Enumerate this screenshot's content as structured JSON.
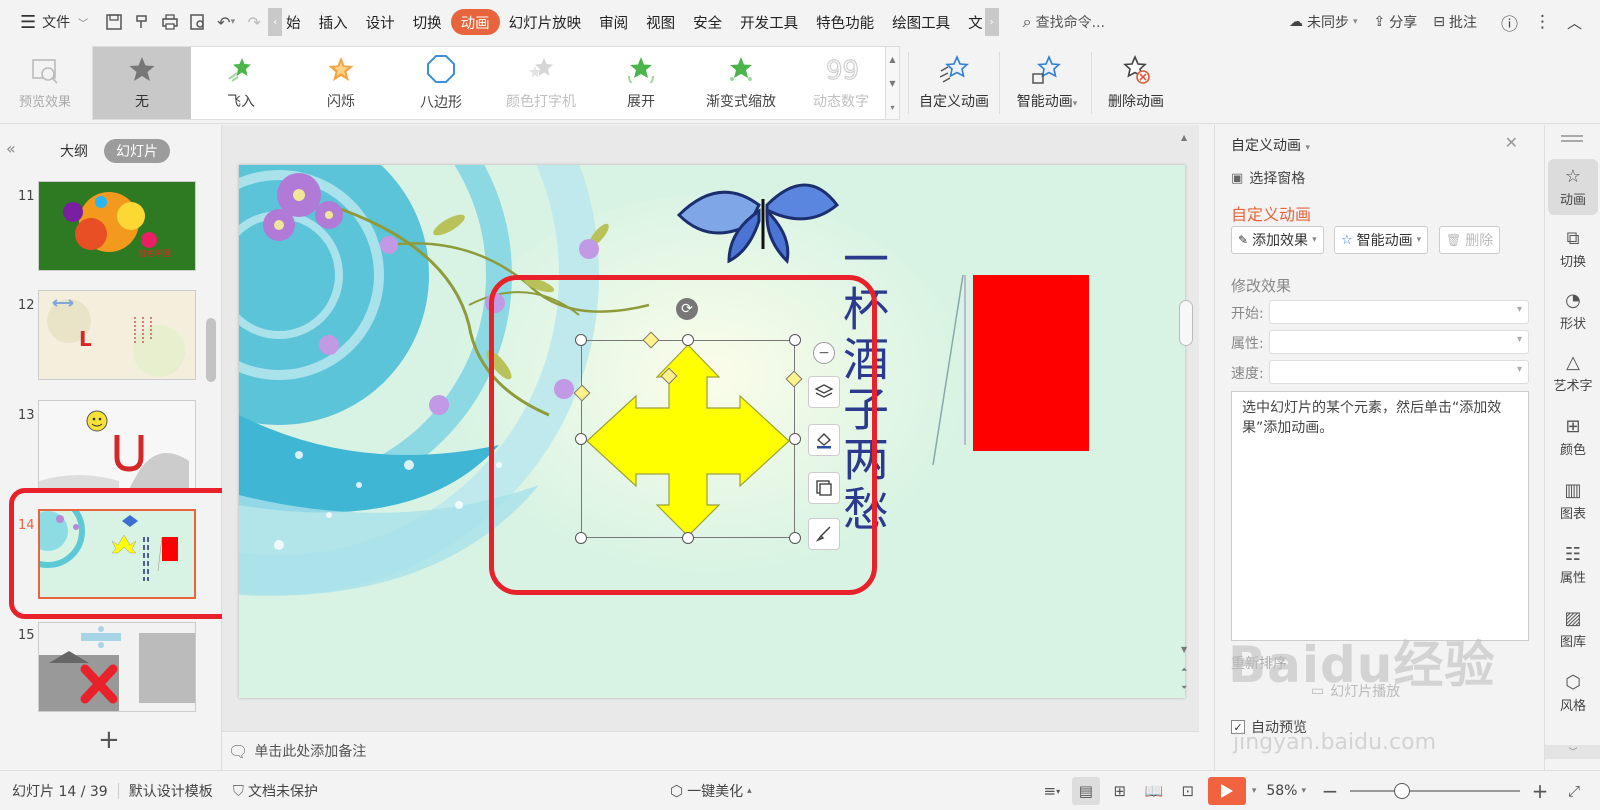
{
  "menubar": {
    "file_label": "文件",
    "tabs": [
      "始",
      "插入",
      "设计",
      "切换",
      "动画",
      "幻灯片放映",
      "审阅",
      "视图",
      "安全",
      "开发工具",
      "特色功能",
      "绘图工具",
      "文"
    ],
    "active_tab": "动画",
    "search_placeholder": "查找命令...",
    "sync_label": "未同步",
    "share_label": "分享",
    "comment_label": "批注"
  },
  "ribbon": {
    "preview_label": "预览效果",
    "gallery": [
      {
        "label": "无",
        "icon": "star-gray-icon",
        "state": "selected"
      },
      {
        "label": "飞入",
        "icon": "star-green-icon",
        "state": "normal"
      },
      {
        "label": "闪烁",
        "icon": "star-orange-icon",
        "state": "normal"
      },
      {
        "label": "八边形",
        "icon": "octagon-icon",
        "state": "normal"
      },
      {
        "label": "颜色打字机",
        "icon": "star-faded-icon",
        "state": "disabled"
      },
      {
        "label": "展开",
        "icon": "star-green-icon",
        "state": "normal"
      },
      {
        "label": "渐变式缩放",
        "icon": "star-green-icon",
        "state": "normal"
      },
      {
        "label": "动态数字",
        "icon": "number-99-icon",
        "state": "disabled"
      }
    ],
    "custom_anim_label": "自定义动画",
    "smart_anim_label": "智能动画",
    "delete_anim_label": "删除动画"
  },
  "left_panel": {
    "tab_outline": "大纲",
    "tab_slides": "幻灯片",
    "slides": [
      {
        "num": "11"
      },
      {
        "num": "12"
      },
      {
        "num": "13"
      },
      {
        "num": "14"
      },
      {
        "num": "15"
      }
    ],
    "current_slide": "14",
    "add_symbol": "+",
    "thumb12_text": "L",
    "thumb11_text": "红色中国"
  },
  "slide": {
    "vertical_text": "一杯酒子两愁"
  },
  "notes": {
    "placeholder": "单击此处添加备注"
  },
  "right_panel": {
    "title": "自定义动画",
    "select_pane": "选择窗格",
    "heading": "自定义动画",
    "add_effect": "添加效果",
    "smart_anim": "智能动画",
    "delete": "删除",
    "modify_label": "修改效果",
    "start_label": "开始:",
    "property_label": "属性:",
    "speed_label": "速度:",
    "hint": "选中幻灯片的某个元素，然后单击“添加效果”添加动画。",
    "reorder_label": "重新排序",
    "play_label": "幻灯片播放",
    "auto_preview": "自动预览"
  },
  "sidebar": [
    {
      "label": "动画",
      "icon": "animation-icon",
      "active": true
    },
    {
      "label": "切换",
      "icon": "transition-icon",
      "active": false
    },
    {
      "label": "形状",
      "icon": "shape-icon",
      "active": false
    },
    {
      "label": "艺术字",
      "icon": "wordart-icon",
      "active": false
    },
    {
      "label": "颜色",
      "icon": "color-icon",
      "active": false
    },
    {
      "label": "图表",
      "icon": "chart-icon",
      "active": false
    },
    {
      "label": "属性",
      "icon": "property-icon",
      "active": false
    },
    {
      "label": "图库",
      "icon": "gallery-icon",
      "active": false
    },
    {
      "label": "风格",
      "icon": "style-icon",
      "active": false
    }
  ],
  "statusbar": {
    "slide_info": "幻灯片 14 / 39",
    "template": "默认设计模板",
    "protect": "文档未保护",
    "beautify": "一键美化",
    "zoom": "58%"
  },
  "watermark": {
    "brand": "Baidu经验",
    "url": "jingyan.baidu.com"
  },
  "colors": {
    "accent": "#e8643c",
    "highlight_red": "#e8212b",
    "slide_bg": "#d8f3e4",
    "shape_yellow": "#ffff00",
    "shape_red": "#ff0000",
    "text_blue": "#2b3a8c"
  }
}
